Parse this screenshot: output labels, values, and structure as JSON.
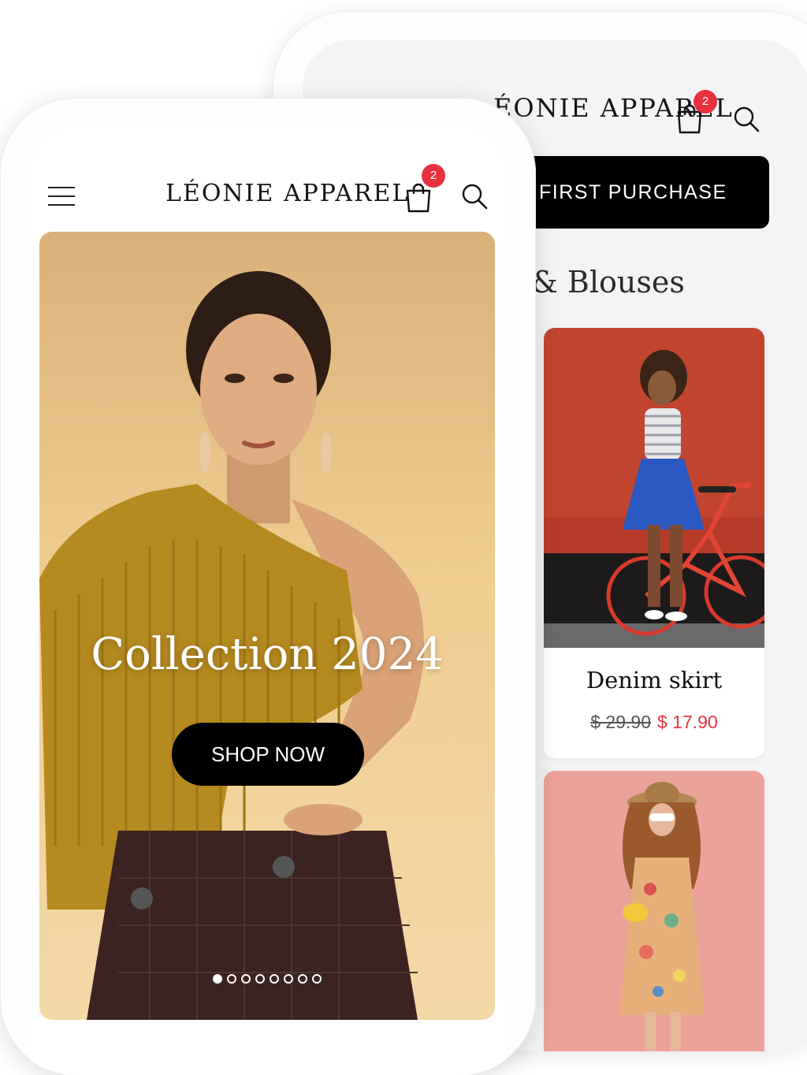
{
  "colors": {
    "accent": "#e8313f",
    "banner_bg": "#000000",
    "badge": "#e8313f"
  },
  "back_screen": {
    "brand_partial": "ÉONIE APPAREL",
    "cart_badge": "2",
    "promo_banner_partial": "FIRST PURCHASE",
    "section_title_partial": "& Blouses",
    "products": [
      {
        "name": "Denim skirt",
        "old_price": "$ 29.90",
        "new_price": "$ 17.90",
        "image": "woman-with-red-bicycle-photo"
      },
      {
        "name": "",
        "image": "woman-in-floral-dress-photo"
      }
    ]
  },
  "front_screen": {
    "brand": "LÉONIE APPAREL",
    "cart_badge": "2",
    "hero": {
      "title": "Collection 2024",
      "button": "SHOP NOW",
      "image": "model-in-mustard-sweater-photo",
      "slides_total": 8,
      "slide_active": 1
    }
  },
  "icons": [
    "menu-icon",
    "shopping-bag-icon",
    "search-icon"
  ]
}
